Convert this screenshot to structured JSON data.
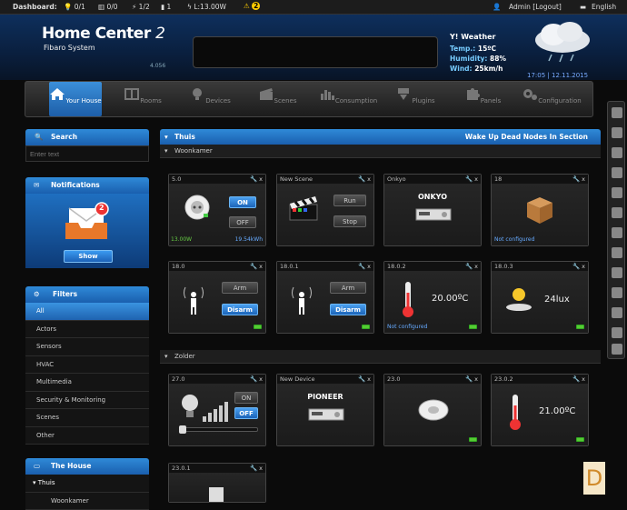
{
  "topbar": {
    "dashboard": "Dashboard:",
    "lights": "0/1",
    "blinds": "0/0",
    "plugs": "1/2",
    "doors": "1",
    "power": "L:13.00W",
    "alerts": "2",
    "admin": "Admin [Logout]",
    "language": "English"
  },
  "header": {
    "title": "Home Center",
    "title_num": "2",
    "subtitle": "Fibaro System",
    "version": "4.056",
    "weather_label": "Weather",
    "temp_label": "Temp.:",
    "temp": "15ºC",
    "humidity_label": "Humidity:",
    "humidity": "88%",
    "wind_label": "Wind:",
    "wind": "25km/h",
    "time": "17:05",
    "date": "12.11.2015"
  },
  "nav": [
    {
      "label": "Your House"
    },
    {
      "label": "Rooms"
    },
    {
      "label": "Devices"
    },
    {
      "label": "Scenes"
    },
    {
      "label": "Consumption"
    },
    {
      "label": "Plugins"
    },
    {
      "label": "Panels"
    },
    {
      "label": "Configuration"
    }
  ],
  "search": {
    "title": "Search",
    "placeholder": "Enter text"
  },
  "notifications": {
    "title": "Notifications",
    "count": "2",
    "button": "Show"
  },
  "filters": {
    "title": "Filters",
    "items": [
      "All",
      "Actors",
      "Sensors",
      "HVAC",
      "Multimedia",
      "Security & Monitoring",
      "Scenes",
      "Other"
    ]
  },
  "house": {
    "title": "The House",
    "section": "Thuis",
    "room": "Woonkamer"
  },
  "main": {
    "section": "Thuis",
    "action": "Wake Up Dead Nodes In Section",
    "room1": "Woonkamer",
    "room2": "Zolder"
  },
  "devices": [
    {
      "id": "5.0",
      "on": "ON",
      "off": "OFF",
      "power": "13.00W",
      "energy": "19.54kWh"
    },
    {
      "id": "New Scene",
      "run": "Run",
      "stop": "Stop"
    },
    {
      "id": "Onkyo",
      "brand": "ONKYO"
    },
    {
      "id": "18",
      "status": "Not configured"
    },
    {
      "id": "18.0",
      "arm": "Arm",
      "disarm": "Disarm"
    },
    {
      "id": "18.0.1",
      "arm": "Arm",
      "disarm": "Disarm"
    },
    {
      "id": "18.0.2",
      "value": "20.00ºC",
      "status": "Not configured"
    },
    {
      "id": "18.0.3",
      "value": "24lux"
    },
    {
      "id": "27.0",
      "on": "ON",
      "off": "OFF"
    },
    {
      "id": "New Device",
      "brand": "PIONEER"
    },
    {
      "id": "23.0"
    },
    {
      "id": "23.0.2",
      "value": "21.00ºC"
    },
    {
      "id": "23.0.1"
    }
  ],
  "watermark": "D"
}
